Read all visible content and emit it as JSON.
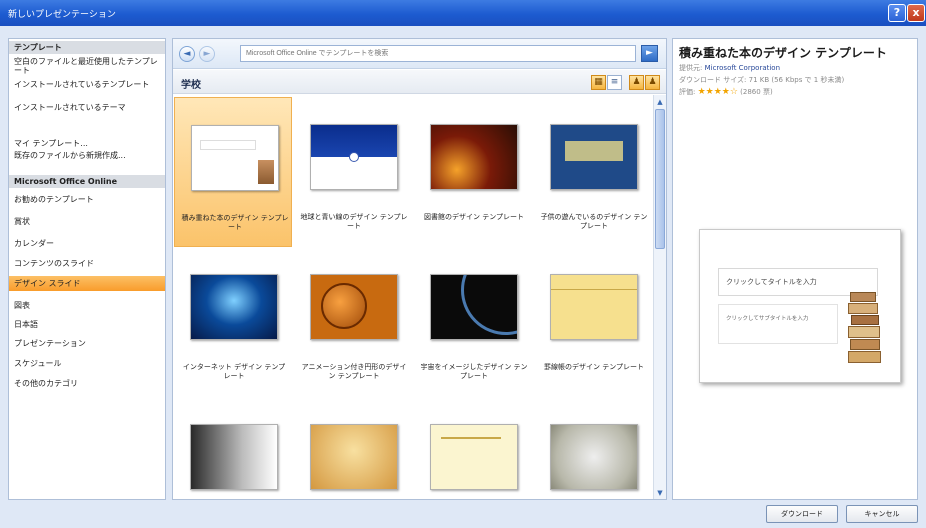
{
  "window": {
    "title": "新しいプレゼンテーション",
    "help_icon": "?",
    "close_icon": "x"
  },
  "nav": {
    "header": "テンプレート",
    "local_items": [
      "空白のファイルと最近使用したテンプレート",
      "インストールされているテンプレート",
      "インストールされているテーマ",
      "マイ テンプレート...",
      "既存のファイルから新規作成..."
    ],
    "online_header": "Microsoft Office Online",
    "online_items": [
      "お勧めのテンプレート",
      "賞状",
      "カレンダー",
      "コンテンツのスライド",
      "デザイン スライド",
      "図表",
      "日本語",
      "プレゼンテーション",
      "スケジュール",
      "その他のカテゴリ"
    ],
    "selected_index": 4
  },
  "search": {
    "placeholder": "Microsoft Office Online でテンプレートを検索",
    "back_icon": "◄",
    "forward_icon": "►",
    "go_icon": "►"
  },
  "category": {
    "title": "学校",
    "view_icons": [
      "large-icons-view-icon",
      "small-icons-view-icon",
      "person-view-icon"
    ]
  },
  "templates": [
    {
      "label": "積み重ねた本のデザイン テンプレート",
      "selected": true
    },
    {
      "label": "地球と青い線のデザイン テンプレート"
    },
    {
      "label": "図書館のデザイン テンプレート"
    },
    {
      "label": "子供の遊んでいるのデザイン テンプレート"
    },
    {
      "label": "インターネット デザイン テンプレート"
    },
    {
      "label": "アニメーション付き円形のデザイン テンプレート"
    },
    {
      "label": "宇宙をイメージしたデザイン テンプレート"
    },
    {
      "label": "罫線帳のデザイン テンプレート"
    },
    {
      "label": ""
    },
    {
      "label": ""
    },
    {
      "label": ""
    },
    {
      "label": ""
    }
  ],
  "details": {
    "title": "積み重ねた本のデザイン テンプレート",
    "provider_label": "提供元:",
    "provider": "Microsoft Corporation",
    "download_size_label": "ダウンロード サイズ:",
    "download_size": "71 KB (56 Kbps で 1 秒未満)",
    "rating_label": "評価:",
    "rating_stars": 4,
    "rating_count": "(2860 票)",
    "preview_title": "クリックしてタイトルを入力",
    "preview_subtitle": "クリックしてサブタイトルを入力"
  },
  "buttons": {
    "download": "ダウンロード",
    "cancel": "キャンセル"
  },
  "colors": {
    "titlebar": "#1d5bd0",
    "selection": "#f99c2b",
    "link": "#2a4a9a"
  }
}
